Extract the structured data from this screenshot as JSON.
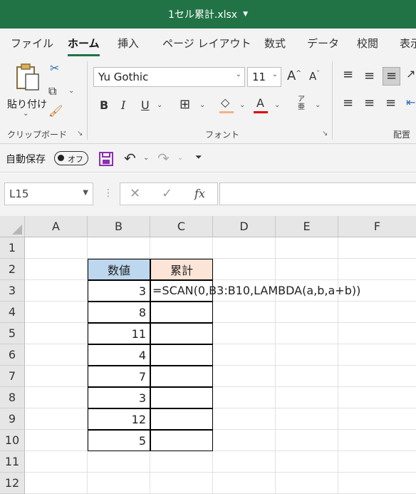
{
  "title": {
    "filename": "1セル累計.xlsx"
  },
  "ribbon_tabs": [
    "ファイル",
    "ホーム",
    "挿入",
    "ページ レイアウト",
    "数式",
    "データ",
    "校閲",
    "表示"
  ],
  "ribbon": {
    "paste_label": "貼り付け",
    "clipboard_label": "クリップボード",
    "font_label": "フォント",
    "alignment_label": "配置",
    "font_name": "Yu Gothic",
    "font_size": "11"
  },
  "qat": {
    "autosave_label": "自動保存",
    "toggle_state": "オフ"
  },
  "formula_bar": {
    "name_box": "L15",
    "fx": "fx",
    "formula": ""
  },
  "columns": [
    "A",
    "B",
    "C",
    "D",
    "E",
    "F"
  ],
  "rows": [
    "1",
    "2",
    "3",
    "4",
    "5",
    "6",
    "7",
    "8",
    "9",
    "10",
    "11",
    "12"
  ],
  "cells": {
    "B2": "数値",
    "C2": "累計",
    "B3": "3",
    "B4": "8",
    "B5": "11",
    "B6": "4",
    "B7": "7",
    "B8": "3",
    "B9": "12",
    "B10": "5",
    "C3": "=SCAN(0,B3:B10,LAMBDA(a,b,a+b))"
  },
  "colors": {
    "header_blue": "#bdd7ee",
    "header_peach": "#fce4d6",
    "excel_green": "#217346",
    "font_red": "#e00000",
    "fill_orange": "#f4b183"
  }
}
